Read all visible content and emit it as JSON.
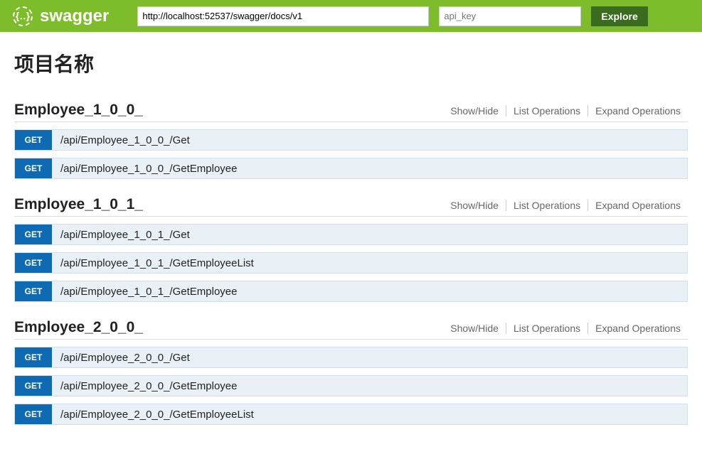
{
  "header": {
    "brand": "swagger",
    "logo_glyph": "{‥}",
    "url_value": "http://localhost:52537/swagger/docs/v1",
    "apikey_placeholder": "api_key",
    "explore_label": "Explore"
  },
  "page": {
    "title": "项目名称"
  },
  "section_actions": {
    "show_hide": "Show/Hide",
    "list_ops": "List Operations",
    "expand_ops": "Expand Operations"
  },
  "sections": [
    {
      "title": "Employee_1_0_0_",
      "ops": [
        {
          "method": "GET",
          "path": "/api/Employee_1_0_0_/Get"
        },
        {
          "method": "GET",
          "path": "/api/Employee_1_0_0_/GetEmployee"
        }
      ]
    },
    {
      "title": "Employee_1_0_1_",
      "ops": [
        {
          "method": "GET",
          "path": "/api/Employee_1_0_1_/Get"
        },
        {
          "method": "GET",
          "path": "/api/Employee_1_0_1_/GetEmployeeList"
        },
        {
          "method": "GET",
          "path": "/api/Employee_1_0_1_/GetEmployee"
        }
      ]
    },
    {
      "title": "Employee_2_0_0_",
      "ops": [
        {
          "method": "GET",
          "path": "/api/Employee_2_0_0_/Get"
        },
        {
          "method": "GET",
          "path": "/api/Employee_2_0_0_/GetEmployee"
        },
        {
          "method": "GET",
          "path": "/api/Employee_2_0_0_/GetEmployeeList"
        }
      ]
    }
  ]
}
